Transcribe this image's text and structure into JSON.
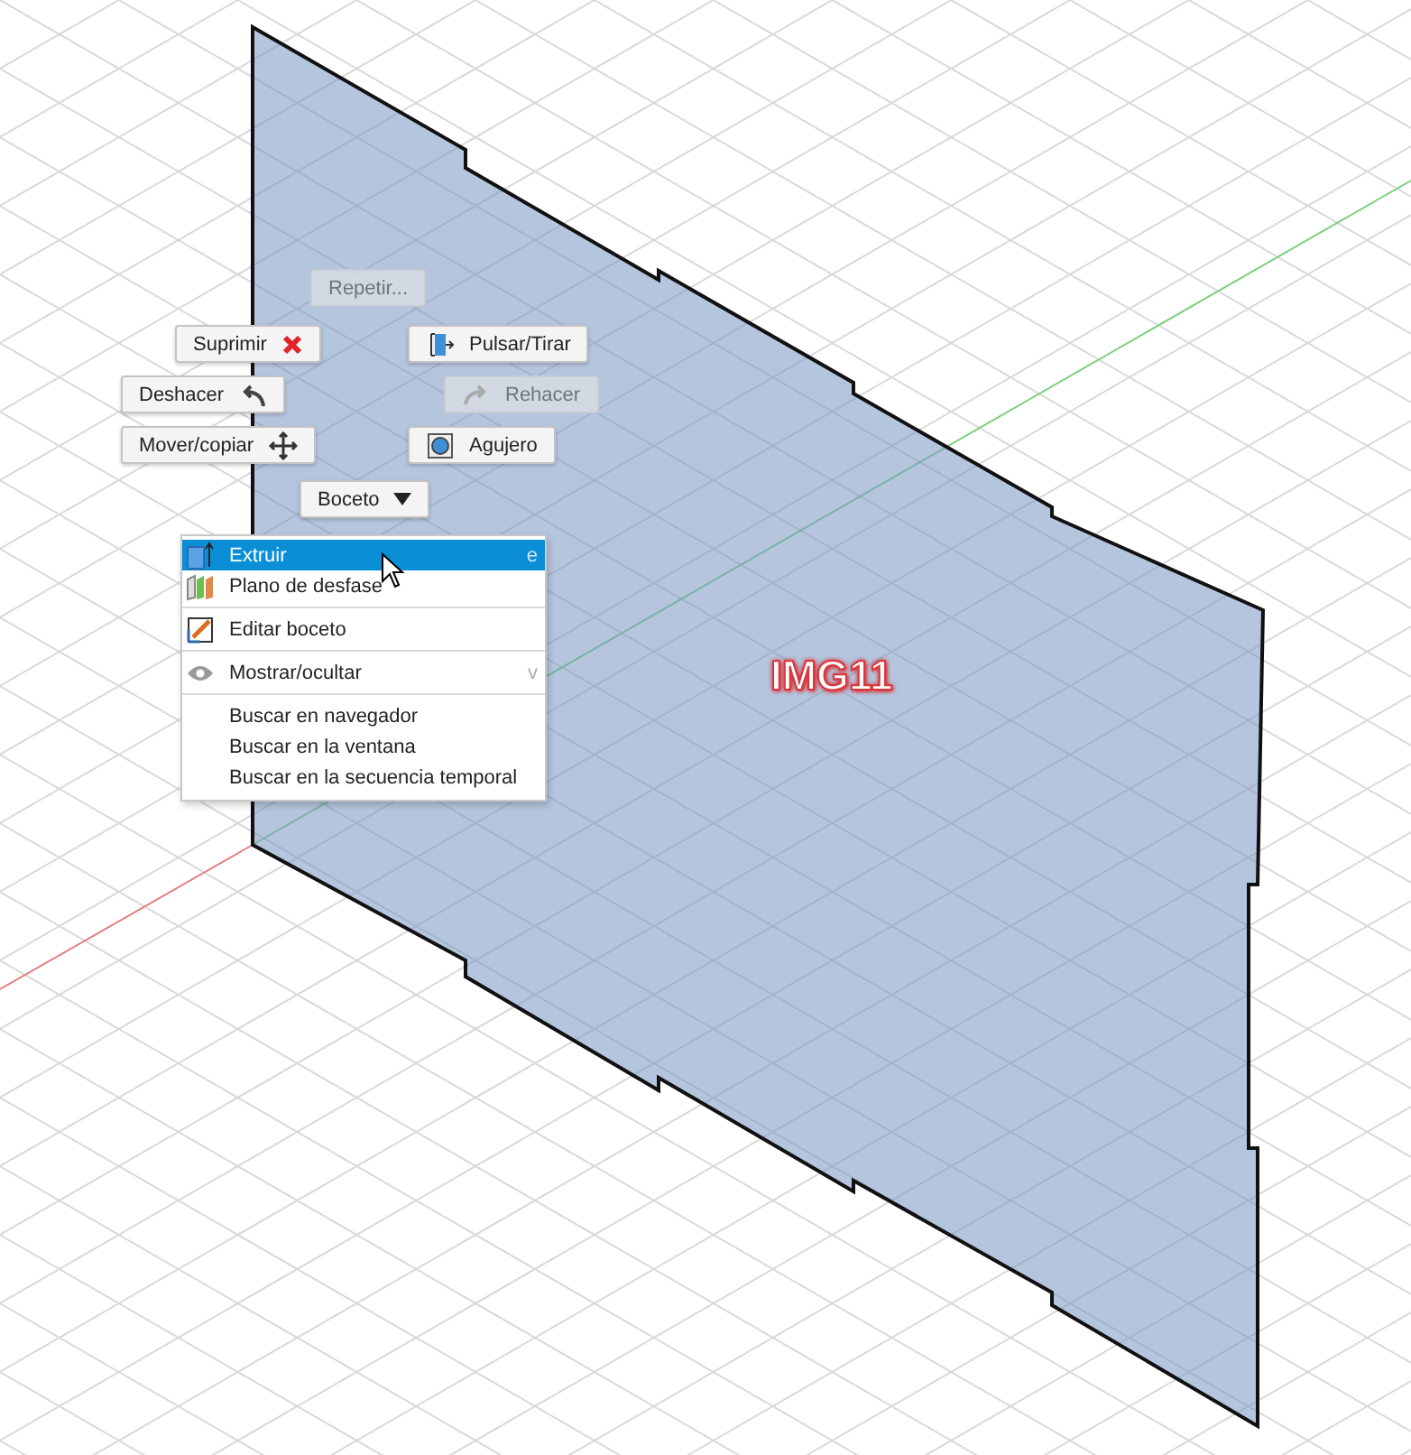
{
  "marking_menu": [
    {
      "label": "Repetir...",
      "disabled": true
    },
    {
      "label": "Suprimir",
      "disabled": false
    },
    {
      "label": "Pulsar/Tirar",
      "disabled": false
    },
    {
      "label": "Deshacer",
      "disabled": false
    },
    {
      "label": "Rehacer",
      "disabled": true
    },
    {
      "label": "Mover/copiar",
      "disabled": false
    },
    {
      "label": "Agujero",
      "disabled": false
    },
    {
      "label": "Boceto",
      "disabled": false
    }
  ],
  "context_menu": {
    "groups": [
      [
        {
          "label": "Extruir",
          "shortcut": "e",
          "selected": true
        },
        {
          "label": "Plano de desfase",
          "selected": false
        }
      ],
      [
        {
          "label": "Editar boceto",
          "selected": false
        }
      ],
      [
        {
          "label": "Mostrar/ocultar",
          "shortcut": "v",
          "selected": false
        }
      ],
      [
        {
          "label": "Buscar en navegador",
          "selected": false
        },
        {
          "label": "Buscar en la ventana",
          "selected": false
        },
        {
          "label": "Buscar en la secuencia temporal",
          "selected": false
        }
      ]
    ]
  },
  "image_label": "IMG11"
}
